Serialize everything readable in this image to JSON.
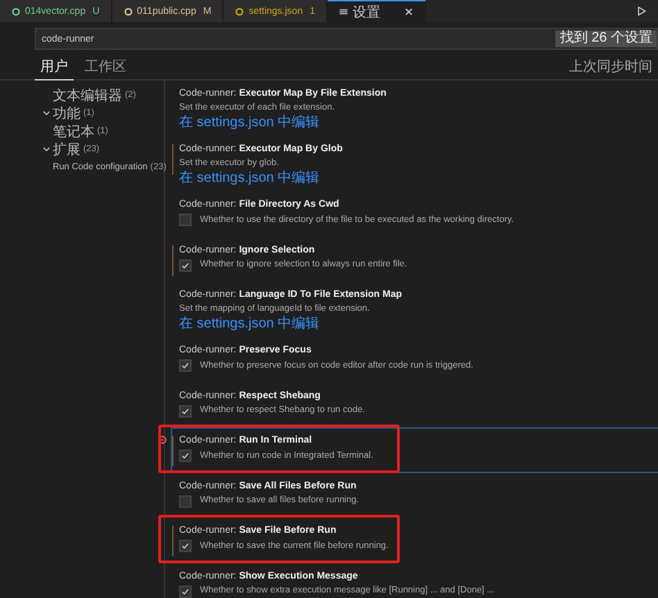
{
  "tabs": [
    {
      "label": "014vector.cpp",
      "status": "U",
      "color": "#73c991",
      "selected": false,
      "closable": false
    },
    {
      "label": "011public.cpp",
      "status": "M",
      "color": "#e2c08d",
      "selected": false,
      "closable": false
    },
    {
      "label": "settings.json",
      "status": "1",
      "color": "#cca700",
      "selected": false,
      "closable": false
    },
    {
      "label": "设置",
      "color": "#cccccc",
      "selected": true,
      "closable": true
    }
  ],
  "search": {
    "value": "code-runner",
    "badge": "找到 26 个设置"
  },
  "scope_tabs": [
    {
      "label": "用户",
      "selected": true
    },
    {
      "label": "工作区",
      "selected": false
    }
  ],
  "sync_note": "上次同步时间",
  "sidebar": {
    "items": [
      {
        "label": "文本编辑器",
        "count": "(2)"
      },
      {
        "label": "功能",
        "count": "(1)",
        "expanded": true,
        "children": [
          {
            "label": "笔记本",
            "count": "(1)"
          }
        ]
      },
      {
        "label": "扩展",
        "count": "(23)",
        "expanded": true,
        "children": [
          {
            "label": "Run Code configuration",
            "count": "(23)"
          }
        ]
      }
    ]
  },
  "settings": [
    {
      "kind": "link",
      "title": "Code-runner: **Executor Map By File Extension**",
      "description": "Set the executor of each file extension.",
      "link": "在 settings.json 中编辑",
      "modified": false,
      "focused": false,
      "highlighted": false
    },
    {
      "kind": "link",
      "title": "Code-runner: **Executor Map By Glob**",
      "description": "Set the executor by glob.",
      "link": "在 settings.json 中编辑",
      "modified": true,
      "focused": false,
      "highlighted": false
    },
    {
      "kind": "checkbox",
      "title": "Code-runner: **File Directory As Cwd**",
      "description": "Whether to use the directory of the file to be executed as the working directory.",
      "checked": false,
      "modified": false,
      "focused": false,
      "highlighted": false
    },
    {
      "kind": "checkbox",
      "title": "Code-runner: **Ignore Selection**",
      "description": "Whether to ignore selection to always run entire file.",
      "checked": true,
      "modified": true,
      "focused": false,
      "highlighted": false
    },
    {
      "kind": "link",
      "title": "Code-runner: **Language ID To File Extension Map**",
      "description": "Set the mapping of languageId to file extension.",
      "link": "在 settings.json 中编辑",
      "modified": false,
      "focused": false,
      "highlighted": false
    },
    {
      "kind": "checkbox",
      "title": "Code-runner: **Preserve Focus**",
      "description": "Whether to preserve focus on code editor after code run is triggered.",
      "checked": true,
      "modified": false,
      "focused": false,
      "highlighted": false
    },
    {
      "kind": "checkbox",
      "title": "Code-runner: **Respect Shebang**",
      "description": "Whether to respect Shebang to run code.",
      "checked": true,
      "modified": false,
      "focused": false,
      "highlighted": false
    },
    {
      "kind": "checkbox",
      "title": "Code-runner: **Run In Terminal**",
      "description": "Whether to run code in Integrated Terminal.",
      "checked": true,
      "modified": true,
      "focused": true,
      "highlighted": true
    },
    {
      "kind": "checkbox",
      "title": "Code-runner: **Save All Files Before Run**",
      "description": "Whether to save all files before running.",
      "checked": false,
      "modified": false,
      "focused": false,
      "highlighted": false
    },
    {
      "kind": "checkbox",
      "title": "Code-runner: **Save File Before Run**",
      "description": "Whether to save the current file before running.",
      "checked": true,
      "modified": true,
      "focused": false,
      "highlighted": true
    },
    {
      "kind": "checkbox",
      "title": "Code-runner: **Show Execution Message**",
      "description": "Whether to show extra execution message like [Running] ... and [Done] ...",
      "checked": true,
      "modified": false,
      "focused": false,
      "highlighted": false
    }
  ]
}
